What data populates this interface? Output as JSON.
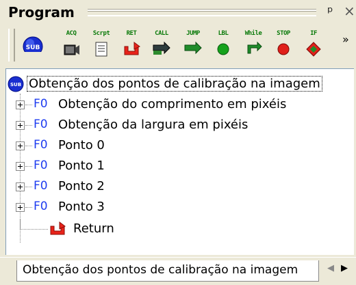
{
  "panel": {
    "title": "Program",
    "pin_icon": "pin-icon",
    "close_icon": "close-icon"
  },
  "toolbar": {
    "buttons": [
      {
        "label": "SUB",
        "icon": "sub-icon"
      },
      {
        "label": "ACQ",
        "icon": "camera-icon"
      },
      {
        "label": "Scrpt",
        "icon": "script-icon"
      },
      {
        "label": "RET",
        "icon": "return-icon"
      },
      {
        "label": "CALL",
        "icon": "call-arrow-icon"
      },
      {
        "label": "JUMP",
        "icon": "jump-arrow-icon"
      },
      {
        "label": "LBL",
        "icon": "label-icon"
      },
      {
        "label": "While",
        "icon": "while-icon"
      },
      {
        "label": "STOP",
        "icon": "stop-icon"
      },
      {
        "label": "IF",
        "icon": "if-icon"
      }
    ],
    "more": "»"
  },
  "tree": {
    "root": {
      "label": "Obtenção dos pontos de calibração na imagem",
      "icon_text": "SUB"
    },
    "items": [
      {
        "prefix": "F0",
        "label": "Obtenção do comprimento em pixéis"
      },
      {
        "prefix": "F0",
        "label": "Obtenção da largura em pixéis"
      },
      {
        "prefix": "F0",
        "label": "Ponto 0"
      },
      {
        "prefix": "F0",
        "label": "Ponto 1"
      },
      {
        "prefix": "F0",
        "label": "Ponto 2"
      },
      {
        "prefix": "F0",
        "label": "Ponto 3"
      }
    ],
    "return_label": "Return"
  },
  "tabbar": {
    "tab_label": "Obtenção dos pontos de calibração na imagem",
    "prev": "◀",
    "next": "▶"
  },
  "colors": {
    "panel_bg": "#ece9d8",
    "fo_blue": "#1e3cf0",
    "tb_label_green": "#0a7a0a"
  }
}
